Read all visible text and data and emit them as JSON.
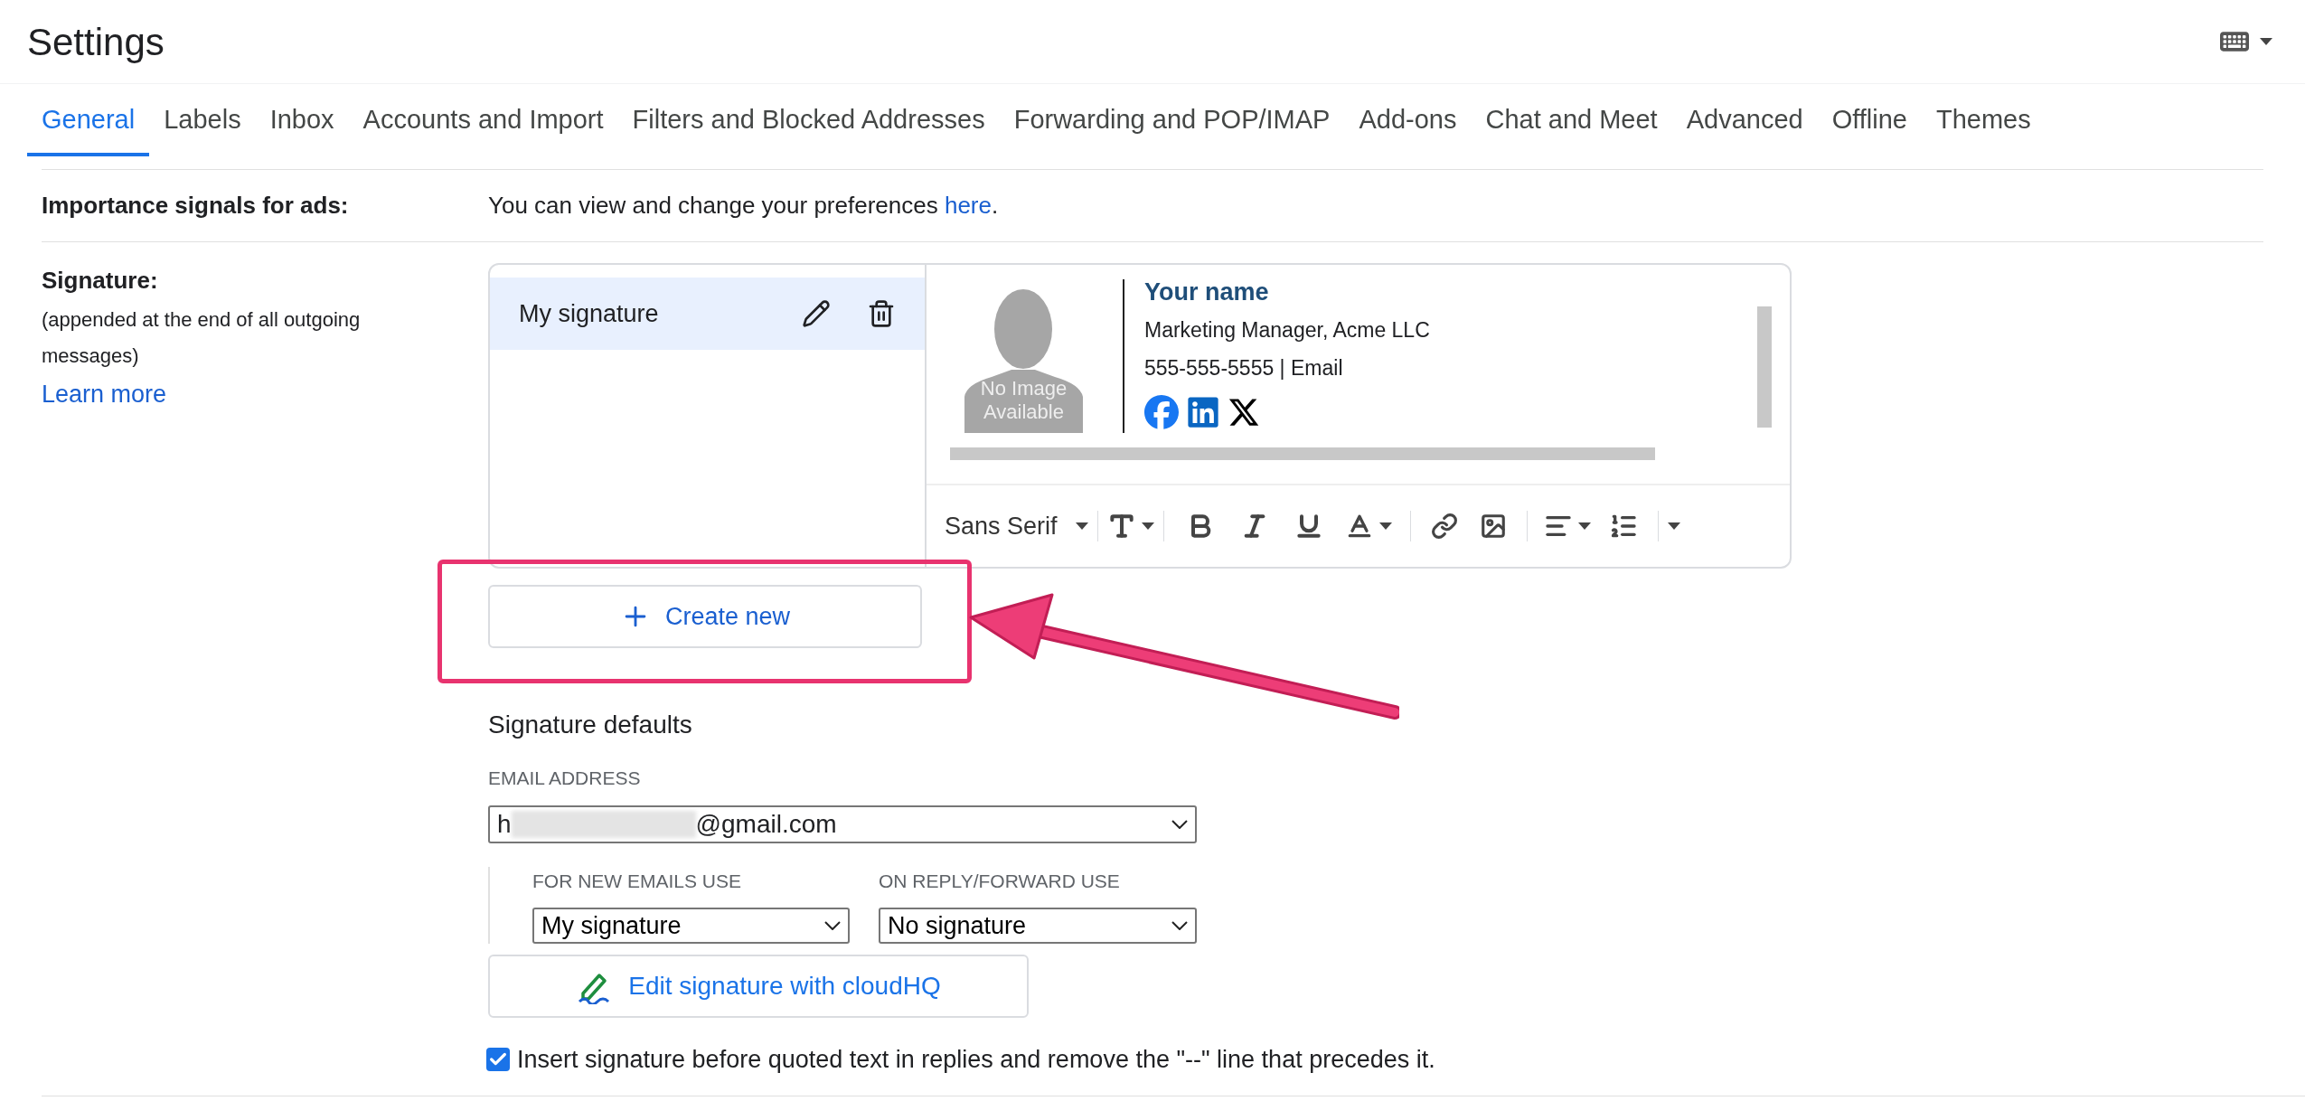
{
  "title": "Settings",
  "tabs": [
    {
      "label": "General",
      "selected": true
    },
    {
      "label": "Labels",
      "selected": false
    },
    {
      "label": "Inbox",
      "selected": false
    },
    {
      "label": "Accounts and Import",
      "selected": false
    },
    {
      "label": "Filters and Blocked Addresses",
      "selected": false
    },
    {
      "label": "Forwarding and POP/IMAP",
      "selected": false
    },
    {
      "label": "Add-ons",
      "selected": false
    },
    {
      "label": "Chat and Meet",
      "selected": false
    },
    {
      "label": "Advanced",
      "selected": false
    },
    {
      "label": "Offline",
      "selected": false
    },
    {
      "label": "Themes",
      "selected": false
    }
  ],
  "importance": {
    "label": "Importance signals for ads:",
    "text": "You can view and change your preferences ",
    "link": "here",
    "after": "."
  },
  "signature": {
    "label": "Signature:",
    "note": "(appended at the end of all outgoing messages)",
    "learn_more": "Learn more",
    "list": [
      {
        "name": "My signature",
        "selected": true
      }
    ],
    "preview": {
      "photo_text": "No Image Available",
      "name": "Your name",
      "role": "Marketing Manager, Acme LLC",
      "contact": "555-555-5555 | Email"
    },
    "toolbar": {
      "font": "Sans Serif"
    },
    "create_new": "Create new"
  },
  "defaults": {
    "heading": "Signature defaults",
    "email_label": "EMAIL ADDRESS",
    "email_start": "h",
    "email_end": "@gmail.com",
    "new_label": "FOR NEW EMAILS USE",
    "new_value": "My signature",
    "reply_label": "ON REPLY/FORWARD USE",
    "reply_value": "No signature",
    "cloudhq": "Edit signature with cloudHQ",
    "insert": {
      "label": "Insert signature before quoted text in replies and remove the \"--\" line that precedes it.",
      "checked": true
    }
  }
}
